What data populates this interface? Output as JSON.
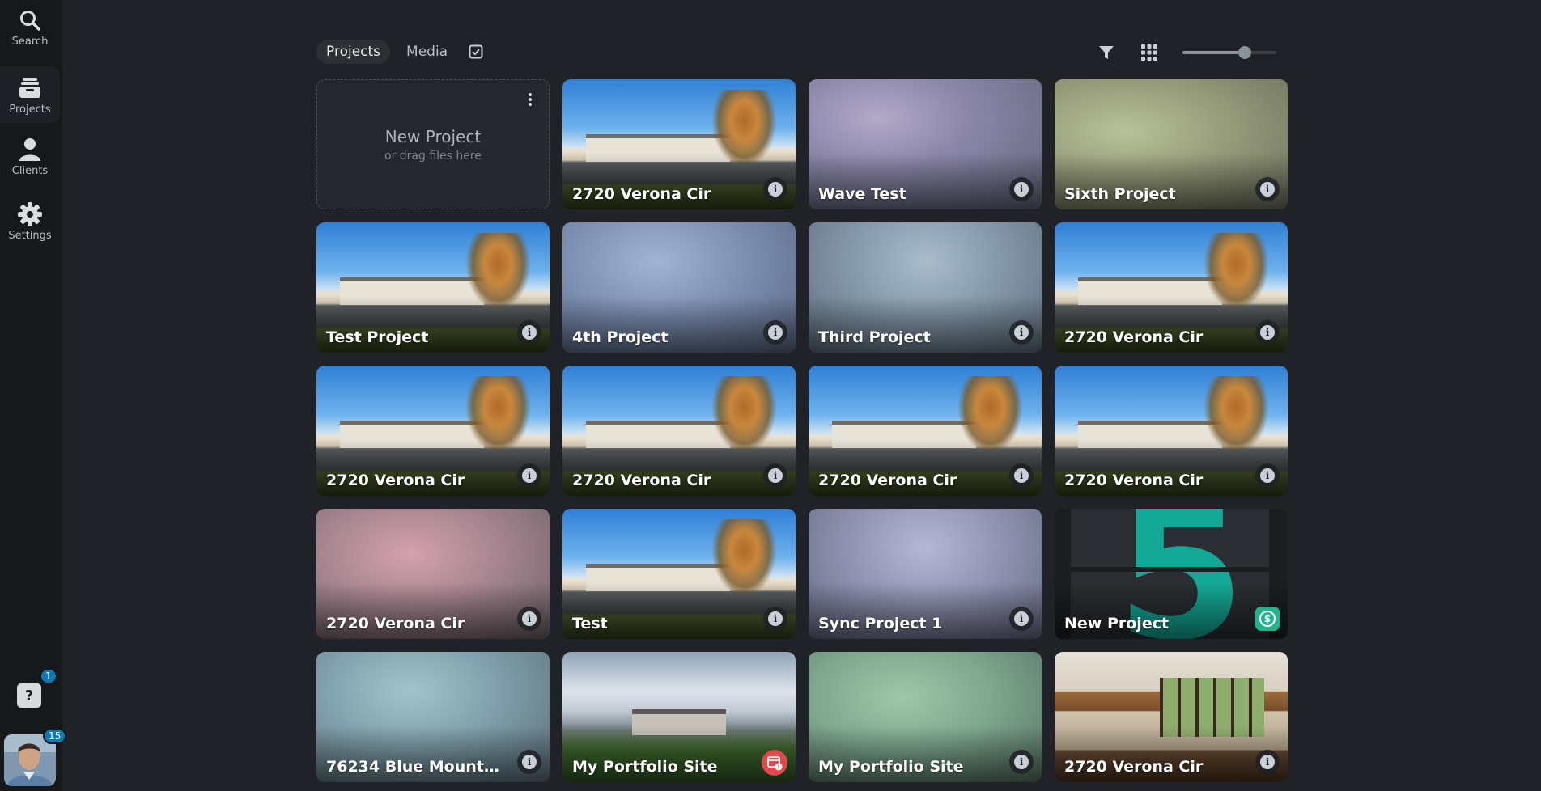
{
  "sidebar": {
    "items": [
      {
        "label": "Search",
        "icon": "search-icon"
      },
      {
        "label": "Projects",
        "icon": "projects-icon"
      },
      {
        "label": "Clients",
        "icon": "person-icon"
      },
      {
        "label": "Settings",
        "icon": "gear-icon"
      }
    ],
    "help_badge": "1",
    "avatar_badge": "15"
  },
  "toolbar": {
    "tabs": [
      "Projects",
      "Media"
    ],
    "active_tab": "Projects",
    "zoom_level": 0.66
  },
  "new_project": {
    "title": "New Project",
    "subtitle": "or drag files here"
  },
  "projects": [
    {
      "title": "2720 Verona Cir",
      "thumb": "house",
      "badge": "info"
    },
    {
      "title": "Wave Test",
      "thumb": "blur-purple",
      "badge": "info"
    },
    {
      "title": "Sixth Project",
      "thumb": "blur-green",
      "badge": "info"
    },
    {
      "title": "Test Project",
      "thumb": "house",
      "badge": "info"
    },
    {
      "title": "4th Project",
      "thumb": "blur-blue",
      "badge": "info"
    },
    {
      "title": "Third Project",
      "thumb": "blur-slate",
      "badge": "info"
    },
    {
      "title": "2720 Verona Cir",
      "thumb": "house",
      "badge": "info"
    },
    {
      "title": "2720 Verona Cir",
      "thumb": "house",
      "badge": "info"
    },
    {
      "title": "2720 Verona Cir",
      "thumb": "house",
      "badge": "info"
    },
    {
      "title": "2720 Verona Cir",
      "thumb": "house",
      "badge": "info"
    },
    {
      "title": "2720 Verona Cir",
      "thumb": "house",
      "badge": "info"
    },
    {
      "title": "2720 Verona Cir",
      "thumb": "blur-pink",
      "badge": "info"
    },
    {
      "title": "Test",
      "thumb": "house",
      "badge": "info"
    },
    {
      "title": "Sync Project 1",
      "thumb": "blur-lav",
      "badge": "info"
    },
    {
      "title": "New Project",
      "thumb": "five",
      "badge": "pay"
    },
    {
      "title": "76234 Blue Mountai...",
      "thumb": "blur-teal",
      "badge": "info"
    },
    {
      "title": "My Portfolio Site",
      "thumb": "pano",
      "badge": "warn"
    },
    {
      "title": "My Portfolio Site",
      "thumb": "blur-mint",
      "badge": "info"
    },
    {
      "title": "2720 Verona Cir",
      "thumb": "interior",
      "badge": "info"
    }
  ]
}
